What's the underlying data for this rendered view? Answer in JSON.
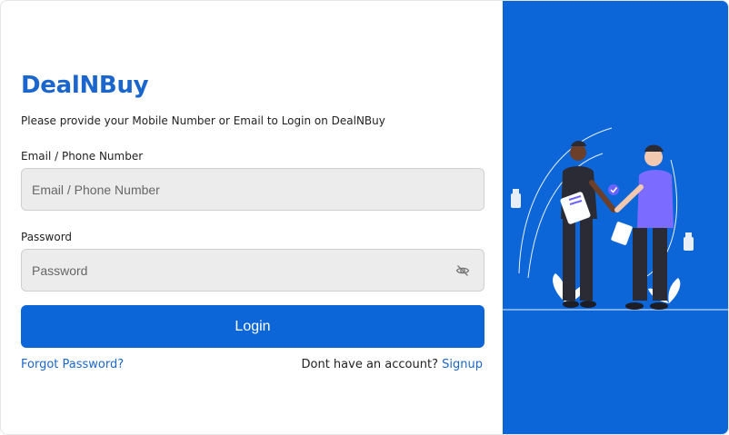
{
  "brand": {
    "name": "DealNBuy"
  },
  "form": {
    "subtitle": "Please provide your Mobile Number or Email to Login on DealNBuy",
    "email_label": "Email / Phone Number",
    "email_placeholder": "Email / Phone Number",
    "password_label": "Password",
    "password_placeholder": "Password",
    "login_button": "Login",
    "forgot_link": "Forgot Password?",
    "signup_prompt": "Dont have an account?",
    "signup_link": "Signup"
  },
  "icons": {
    "password_toggle": "eye-slash-icon",
    "illustration": "handshake-illustration"
  },
  "colors": {
    "brand": "#1a66cc",
    "primary_button": "#0c66d8",
    "panel": "#0c66d8",
    "input_bg": "#ececec"
  }
}
